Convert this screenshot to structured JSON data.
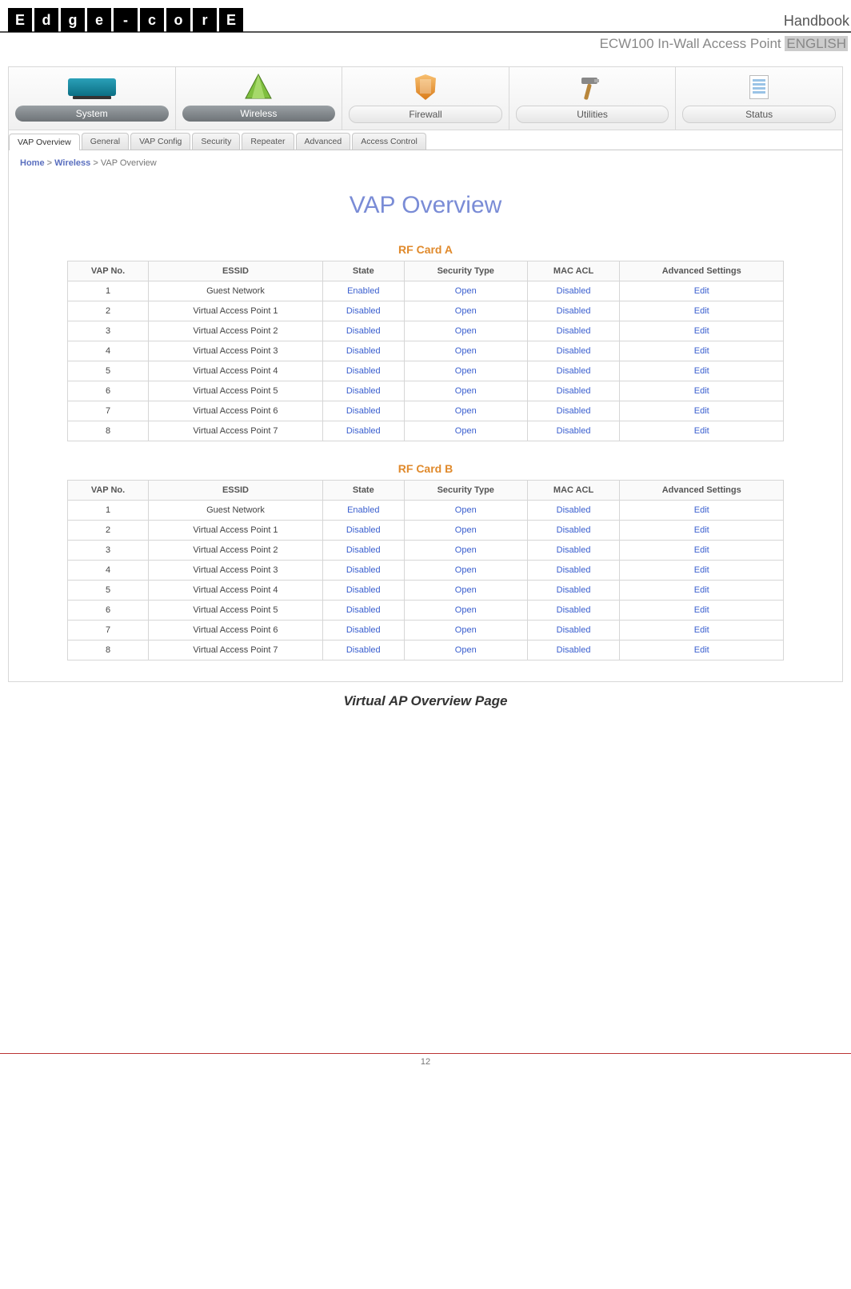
{
  "logo_chars": [
    "E",
    "d",
    "g",
    "e",
    "-",
    "c",
    "o",
    "r",
    "E"
  ],
  "header": {
    "handbook": "Handbook",
    "subtitle_prefix": "ECW100 In-Wall Access Point ",
    "subtitle_lang": "ENGLISH"
  },
  "main_tabs": [
    {
      "label": "System",
      "dark": true
    },
    {
      "label": "Wireless",
      "dark": true
    },
    {
      "label": "Firewall",
      "dark": false
    },
    {
      "label": "Utilities",
      "dark": false
    },
    {
      "label": "Status",
      "dark": false
    }
  ],
  "sub_tabs": [
    "VAP Overview",
    "General",
    "VAP Config",
    "Security",
    "Repeater",
    "Advanced",
    "Access Control"
  ],
  "active_sub_tab": 0,
  "breadcrumb": {
    "home": "Home",
    "sect": "Wireless",
    "page": "VAP Overview",
    "sep": ">"
  },
  "page_title": "VAP Overview",
  "columns": [
    "VAP No.",
    "ESSID",
    "State",
    "Security Type",
    "MAC ACL",
    "Advanced Settings"
  ],
  "cards": [
    {
      "title": "RF Card A",
      "rows": [
        {
          "no": "1",
          "essid": "Guest Network",
          "state": "Enabled",
          "sec": "Open",
          "acl": "Disabled",
          "adv": "Edit"
        },
        {
          "no": "2",
          "essid": "Virtual Access Point 1",
          "state": "Disabled",
          "sec": "Open",
          "acl": "Disabled",
          "adv": "Edit"
        },
        {
          "no": "3",
          "essid": "Virtual Access Point 2",
          "state": "Disabled",
          "sec": "Open",
          "acl": "Disabled",
          "adv": "Edit"
        },
        {
          "no": "4",
          "essid": "Virtual Access Point 3",
          "state": "Disabled",
          "sec": "Open",
          "acl": "Disabled",
          "adv": "Edit"
        },
        {
          "no": "5",
          "essid": "Virtual Access Point 4",
          "state": "Disabled",
          "sec": "Open",
          "acl": "Disabled",
          "adv": "Edit"
        },
        {
          "no": "6",
          "essid": "Virtual Access Point 5",
          "state": "Disabled",
          "sec": "Open",
          "acl": "Disabled",
          "adv": "Edit"
        },
        {
          "no": "7",
          "essid": "Virtual Access Point 6",
          "state": "Disabled",
          "sec": "Open",
          "acl": "Disabled",
          "adv": "Edit"
        },
        {
          "no": "8",
          "essid": "Virtual Access Point 7",
          "state": "Disabled",
          "sec": "Open",
          "acl": "Disabled",
          "adv": "Edit"
        }
      ]
    },
    {
      "title": "RF Card B",
      "rows": [
        {
          "no": "1",
          "essid": "Guest Network",
          "state": "Enabled",
          "sec": "Open",
          "acl": "Disabled",
          "adv": "Edit"
        },
        {
          "no": "2",
          "essid": "Virtual Access Point 1",
          "state": "Disabled",
          "sec": "Open",
          "acl": "Disabled",
          "adv": "Edit"
        },
        {
          "no": "3",
          "essid": "Virtual Access Point 2",
          "state": "Disabled",
          "sec": "Open",
          "acl": "Disabled",
          "adv": "Edit"
        },
        {
          "no": "4",
          "essid": "Virtual Access Point 3",
          "state": "Disabled",
          "sec": "Open",
          "acl": "Disabled",
          "adv": "Edit"
        },
        {
          "no": "5",
          "essid": "Virtual Access Point 4",
          "state": "Disabled",
          "sec": "Open",
          "acl": "Disabled",
          "adv": "Edit"
        },
        {
          "no": "6",
          "essid": "Virtual Access Point 5",
          "state": "Disabled",
          "sec": "Open",
          "acl": "Disabled",
          "adv": "Edit"
        },
        {
          "no": "7",
          "essid": "Virtual Access Point 6",
          "state": "Disabled",
          "sec": "Open",
          "acl": "Disabled",
          "adv": "Edit"
        },
        {
          "no": "8",
          "essid": "Virtual Access Point 7",
          "state": "Disabled",
          "sec": "Open",
          "acl": "Disabled",
          "adv": "Edit"
        }
      ]
    }
  ],
  "caption": "Virtual AP Overview Page",
  "page_number": "12"
}
